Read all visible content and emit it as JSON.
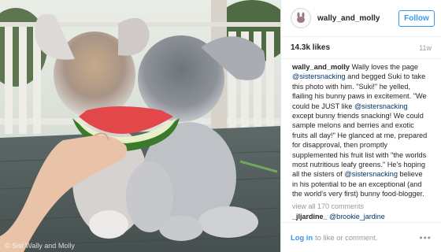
{
  "post": {
    "username": "wally_and_molly",
    "follow_label": "Follow",
    "likes": "14.3k likes",
    "time_ago": "11w",
    "caption_parts": [
      {
        "t": "b",
        "v": "wally_and_molly"
      },
      {
        "t": "s",
        "v": " Wally loves the page "
      },
      {
        "t": "h",
        "v": "@sistersnacking"
      },
      {
        "t": "s",
        "v": " and begged Suki to take this photo with him. \"Suki!\" he yelled, flailing his bunny paws in excitement. \"We could be JUST like "
      },
      {
        "t": "h",
        "v": "@sistersnacking"
      },
      {
        "t": "s",
        "v": " except bunny friends snacking! We could sample melons and berries and exotic fruits all day!\" He glanced at me, prepared for disapproval, then promptly supplemented his fruit list with \"the worlds most nutritious leafy greens.\" He's hoping all the sisters of "
      },
      {
        "t": "h",
        "v": "@sistersnacking"
      },
      {
        "t": "s",
        "v": " believe in his potential to be an exceptional (and the world's very first) bunny food-blogger."
      }
    ],
    "view_all": "view all 170 comments",
    "comment": {
      "user": "_jljardine_",
      "mention": "@brookie_jardine"
    },
    "footer_login": "Log in",
    "footer_rest": "to like or comment.",
    "more_icon": "•••",
    "watermark": "© Sisi Wally and Molly"
  },
  "colors": {
    "link": "#3897f0",
    "mention": "#003569",
    "muted": "#999999"
  }
}
